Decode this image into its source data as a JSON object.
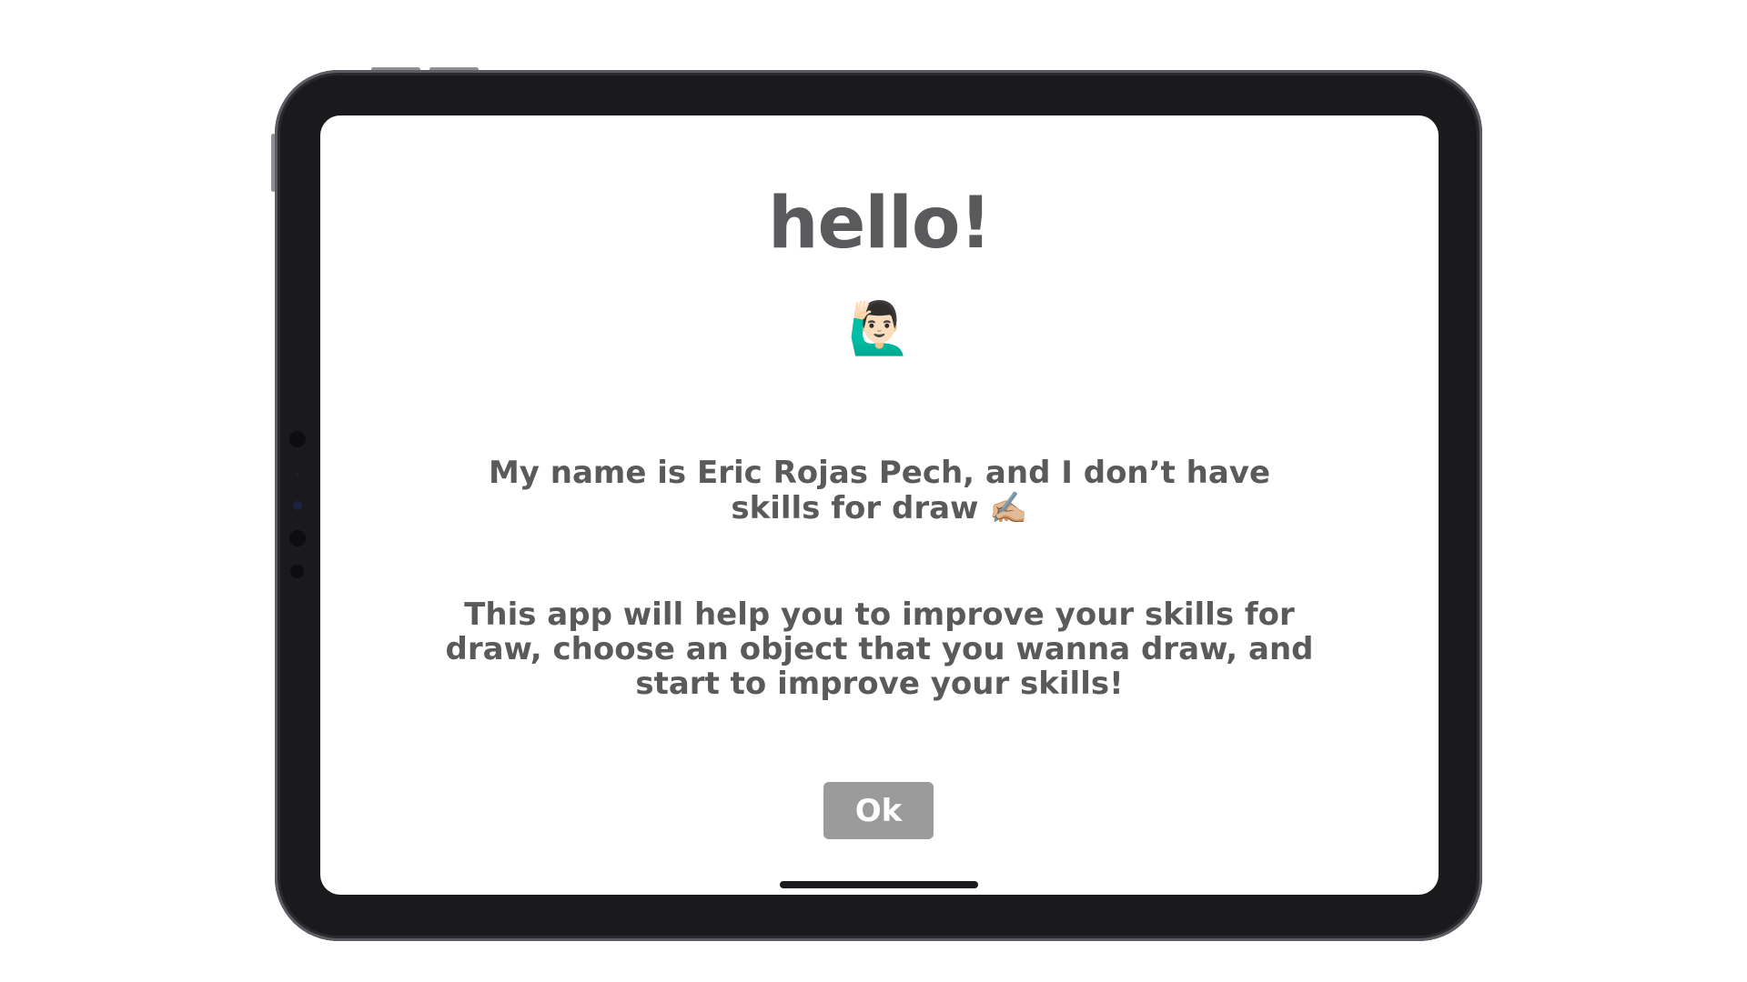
{
  "screen": {
    "title": "hello!",
    "wave_emoji": "🙋🏻‍♂️",
    "intro_text": "My name is Eric Rojas Pech, and I don’t have skills for draw ✍🏼",
    "description": "This app will help you to improve your skills for draw, choose an object that you wanna draw, and start to improve your skills!",
    "ok_label": "Ok"
  },
  "colors": {
    "text": "#5a5a5c",
    "button_bg": "#9b9b9b",
    "button_text": "#ffffff",
    "device_frame": "#1a1a1c",
    "screen_bg": "#ffffff"
  }
}
